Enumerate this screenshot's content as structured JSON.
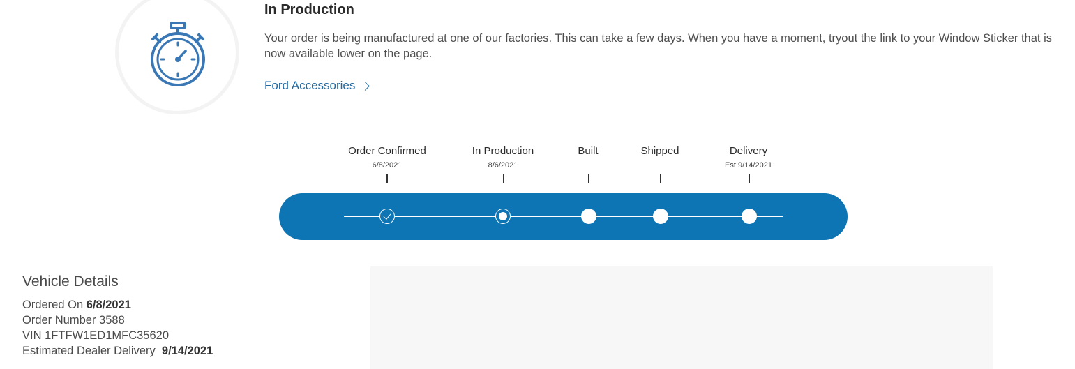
{
  "status": {
    "icon": "stopwatch-icon",
    "title": "In Production",
    "description": "Your order is being manufactured at one of our factories. This can take a few days. When you have a moment, tryout the link to your Window Sticker that is now available lower on the page.",
    "link_label": "Ford Accessories"
  },
  "tracker": {
    "steps": [
      {
        "name": "Order Confirmed",
        "date": "6/8/2021",
        "state": "done"
      },
      {
        "name": "In Production",
        "date": "8/6/2021",
        "state": "current"
      },
      {
        "name": "Built",
        "date": "",
        "state": "upcoming"
      },
      {
        "name": "Shipped",
        "date": "",
        "state": "upcoming"
      },
      {
        "name": "Delivery",
        "date": "Est.9/14/2021",
        "state": "upcoming"
      }
    ]
  },
  "vehicle": {
    "title": "Vehicle Details",
    "ordered_on_label": "Ordered On",
    "ordered_on_value": "6/8/2021",
    "order_number_label": "Order Number",
    "order_number_value": "3588",
    "vin_label": "VIN",
    "vin_value": "1FTFW1ED1MFC35620",
    "delivery_label": "Estimated Dealer Delivery",
    "delivery_value": "9/14/2021"
  },
  "colors": {
    "brand_blue": "#0d75b4",
    "link_blue": "#1f6aa5",
    "icon_blue": "#3a78b5"
  }
}
